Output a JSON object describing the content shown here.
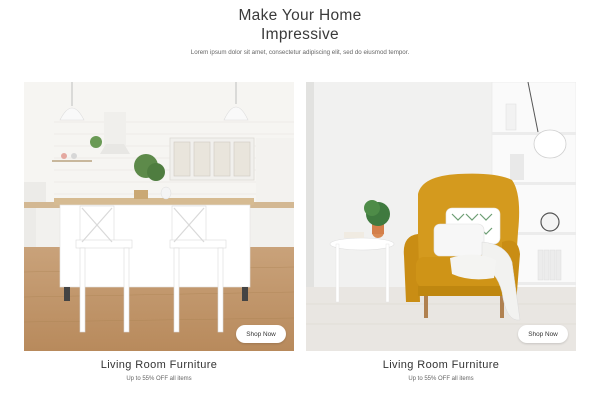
{
  "header": {
    "title_line1": "Make Your Home",
    "title_line2": "Impressive",
    "subtitle": "Lorem ipsum dolor sit amet, consectetur adipiscing elit, sed do eiusmod tempor."
  },
  "cards": [
    {
      "title": "Living Room Furniture",
      "subtitle": "Up to 55% OFF all items",
      "button_label": "Shop Now"
    },
    {
      "title": "Living Room Furniture",
      "subtitle": "Up to 55% OFF all items",
      "button_label": "Shop Now"
    }
  ],
  "colors": {
    "text": "#333333",
    "armchair": "#d49a1e",
    "floor_wood": "#c79e72",
    "wall": "#f4f4f2"
  }
}
